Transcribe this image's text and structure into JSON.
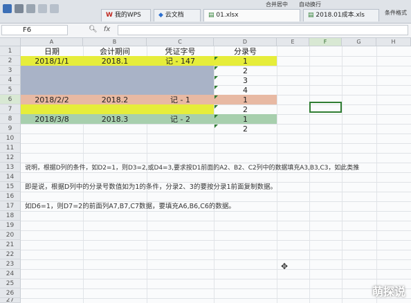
{
  "toolbar": {
    "tabs": [
      {
        "label": "我的WPS"
      },
      {
        "label": "云文档"
      },
      {
        "label": "01.xlsx"
      },
      {
        "label": "2018.01成本.xls"
      }
    ],
    "ribbon": {
      "merge_center": "合并居中",
      "auto_wrap": "自动换行",
      "condition_format": "条件格式"
    }
  },
  "formula_bar": {
    "cell_ref": "F6",
    "fx": "fx",
    "value": ""
  },
  "sheet": {
    "columns": [
      "A",
      "B",
      "C",
      "D",
      "E",
      "F",
      "G",
      "H"
    ],
    "rows": [
      "1",
      "2",
      "3",
      "4",
      "5",
      "6",
      "7",
      "8",
      "9",
      "10",
      "11",
      "12",
      "13",
      "14",
      "15",
      "16",
      "17",
      "18",
      "19",
      "20",
      "21",
      "22",
      "23",
      "24",
      "25",
      "26",
      "27"
    ],
    "header": {
      "A1": "日期",
      "B1": "会计期间",
      "C1": "凭证字号",
      "D1": "分录号"
    },
    "cells": {
      "A2": "2018/1/1",
      "B2": "2018.1",
      "C2": "记 - 147",
      "D2": "1",
      "D3": "2",
      "D4": "3",
      "D5": "4",
      "A6": "2018/2/2",
      "B6": "2018.2",
      "C6": "记 - 1",
      "D6": "1",
      "D7": "2",
      "A8": "2018/3/8",
      "B8": "2018.3",
      "C8": "记 - 2",
      "D8": "1",
      "D9": "2"
    },
    "notes": {
      "row12": "说明，根据D列的条件，如D2=1，则D3=2,或D4=3,要求按D1前面的A2、B2、C2列中的数据填充A3,B3,C3，如此类推",
      "row14": "即是说，根据D列中的分录号数值如为1的条件，分录2、3的要按分录1前面复制数据。",
      "row16": "如D6=1，则D7=2的前面列A7,B7,C7数据，要填充A6,B6,C6的数据。"
    }
  },
  "watermark": "萌探说",
  "colors": {
    "yellow": "#e6ed3a",
    "blue_gray": "#a9b3c7",
    "salmon": "#e8b9a3",
    "green": "#a7cfad",
    "selection_green": "#2f7d32"
  }
}
